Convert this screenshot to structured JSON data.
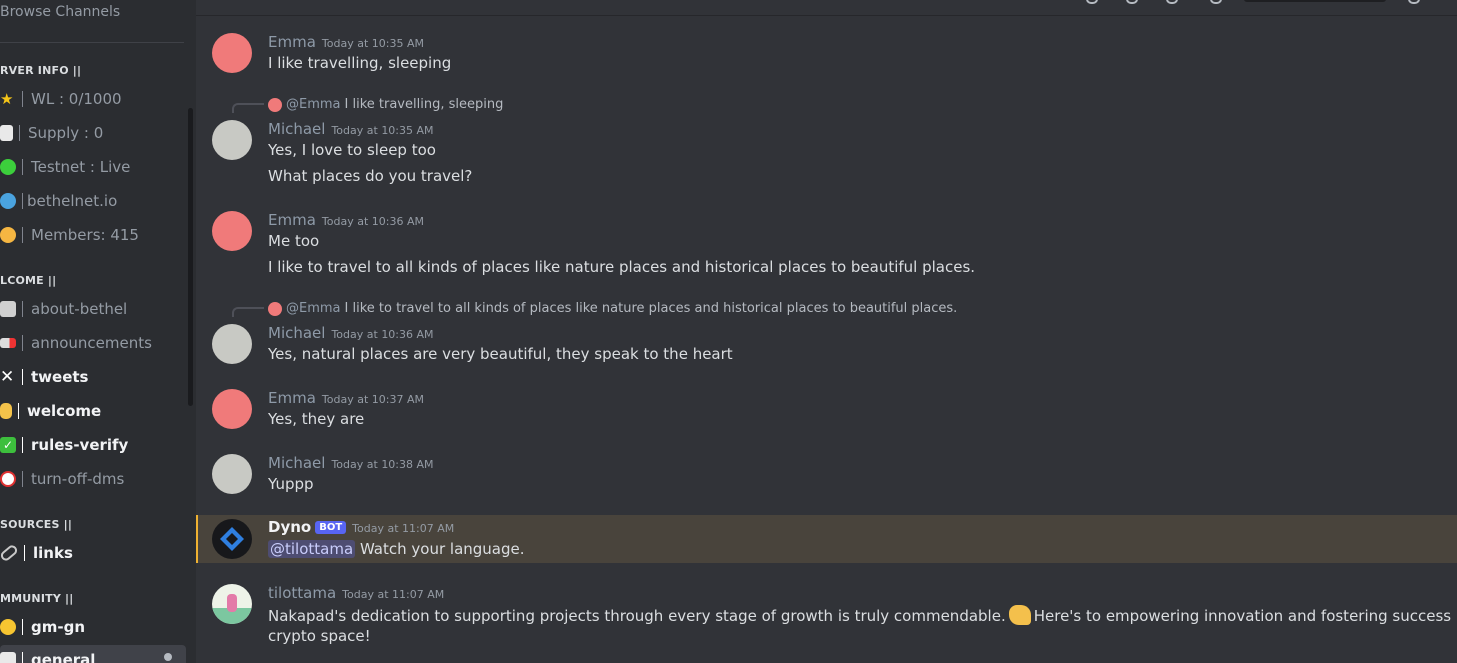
{
  "sidebar": {
    "browse": "Browse Channels",
    "categories": {
      "server_info": "RVER INFO ||",
      "welcome": "LCOME ||",
      "sources": "SOURCES ||",
      "community": "MMUNITY ||"
    },
    "channels": [
      {
        "label": "WL : 0/1000",
        "emoji": "star-icon"
      },
      {
        "label": "Supply : 0",
        "emoji": "page-icon"
      },
      {
        "label": "Testnet : Live",
        "emoji": "green-circle-icon"
      },
      {
        "label": "bethelnet.io",
        "emoji": "globe-icon"
      },
      {
        "label": "Members: 415",
        "emoji": "face-icon"
      },
      {
        "label": "about-bethel",
        "emoji": "printer-icon"
      },
      {
        "label": "announcements",
        "emoji": "megaphone-icon"
      },
      {
        "label": "tweets",
        "emoji": "x-icon"
      },
      {
        "label": "welcome",
        "emoji": "victory-hand-icon"
      },
      {
        "label": "rules-verify",
        "emoji": "check-box-icon"
      },
      {
        "label": "turn-off-dms",
        "emoji": "no-entry-icon"
      },
      {
        "label": "links",
        "emoji": "link-icon"
      },
      {
        "label": "gm-gn",
        "emoji": "sun-icon"
      },
      {
        "label": "general",
        "emoji": "speech-icon"
      }
    ]
  },
  "messages": {
    "m1": {
      "author": "Emma",
      "time": "Today at 10:35 AM",
      "lines": [
        "I like travelling, sleeping"
      ]
    },
    "m2": {
      "reply_to": "@Emma",
      "reply_text": "I like travelling, sleeping",
      "author": "Michael",
      "time": "Today at 10:35 AM",
      "lines": [
        "Yes, I love to sleep too",
        "What places do you travel?"
      ]
    },
    "m3": {
      "author": "Emma",
      "time": "Today at 10:36 AM",
      "lines": [
        "Me too",
        "I like to travel to all kinds of places like nature places and historical places to beautiful places."
      ]
    },
    "m4": {
      "reply_to": "@Emma",
      "reply_text": "I like to travel to all kinds of places like nature places and historical places to beautiful places.",
      "author": "Michael",
      "time": "Today at 10:36 AM",
      "lines": [
        "Yes, natural places are very beautiful, they speak to the heart"
      ]
    },
    "m5": {
      "author": "Emma",
      "time": "Today at 10:37 AM",
      "lines": [
        "Yes, they are"
      ]
    },
    "m6": {
      "author": "Michael",
      "time": "Today at 10:38 AM",
      "lines": [
        "Yuppp"
      ]
    },
    "m7": {
      "author": "Dyno",
      "badge": "BOT",
      "time": "Today at 11:07 AM",
      "mention": "@tilottama",
      "text": "Watch your language."
    },
    "m8": {
      "author": "tilottama",
      "time": "Today at 11:07 AM",
      "line1a": "Nakapad's dedication to supporting projects through every stage of growth is truly commendable.",
      "line1b": "Here's to empowering innovation and fostering success in the",
      "line2": "crypto space!"
    }
  },
  "colors": {
    "background": "#313338",
    "sidebar": "#2b2d31",
    "highlight": "#49443c",
    "highlight_border": "#f0b232",
    "bot_badge": "#5865f2"
  }
}
